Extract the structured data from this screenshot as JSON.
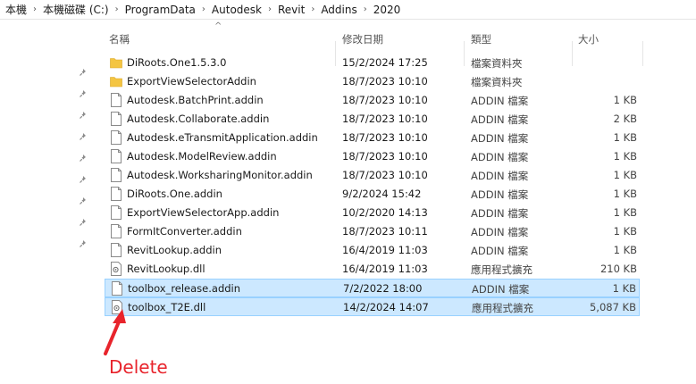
{
  "breadcrumb": {
    "items": [
      "本機",
      "本機磁碟 (C:)",
      "ProgramData",
      "Autodesk",
      "Revit",
      "Addins",
      "2020"
    ]
  },
  "columns": {
    "name": "名稱",
    "date": "修改日期",
    "type": "類型",
    "size": "大小"
  },
  "files": [
    {
      "name": "DiRoots.One1.5.3.0",
      "date": "15/2/2024 17:25",
      "type": "檔案資料夾",
      "size": "",
      "icon": "folder-icon"
    },
    {
      "name": "ExportViewSelectorAddin",
      "date": "18/7/2023 10:10",
      "type": "檔案資料夾",
      "size": "",
      "icon": "folder-icon"
    },
    {
      "name": "Autodesk.BatchPrint.addin",
      "date": "18/7/2023 10:10",
      "type": "ADDIN 檔案",
      "size": "1 KB",
      "icon": "file-icon"
    },
    {
      "name": "Autodesk.Collaborate.addin",
      "date": "18/7/2023 10:10",
      "type": "ADDIN 檔案",
      "size": "2 KB",
      "icon": "file-icon"
    },
    {
      "name": "Autodesk.eTransmitApplication.addin",
      "date": "18/7/2023 10:10",
      "type": "ADDIN 檔案",
      "size": "1 KB",
      "icon": "file-icon"
    },
    {
      "name": "Autodesk.ModelReview.addin",
      "date": "18/7/2023 10:10",
      "type": "ADDIN 檔案",
      "size": "1 KB",
      "icon": "file-icon"
    },
    {
      "name": "Autodesk.WorksharingMonitor.addin",
      "date": "18/7/2023 10:10",
      "type": "ADDIN 檔案",
      "size": "1 KB",
      "icon": "file-icon"
    },
    {
      "name": "DiRoots.One.addin",
      "date": "9/2/2024 15:42",
      "type": "ADDIN 檔案",
      "size": "1 KB",
      "icon": "file-icon"
    },
    {
      "name": "ExportViewSelectorApp.addin",
      "date": "10/2/2020 14:13",
      "type": "ADDIN 檔案",
      "size": "1 KB",
      "icon": "file-icon"
    },
    {
      "name": "FormItConverter.addin",
      "date": "18/7/2023 10:11",
      "type": "ADDIN 檔案",
      "size": "1 KB",
      "icon": "file-icon"
    },
    {
      "name": "RevitLookup.addin",
      "date": "16/4/2019 11:03",
      "type": "ADDIN 檔案",
      "size": "1 KB",
      "icon": "file-icon"
    },
    {
      "name": "RevitLookup.dll",
      "date": "16/4/2019 11:03",
      "type": "應用程式擴充",
      "size": "210 KB",
      "icon": "dll-icon"
    },
    {
      "name": "toolbox_release.addin",
      "date": "7/2/2022 18:00",
      "type": "ADDIN 檔案",
      "size": "1 KB",
      "icon": "file-icon",
      "selected": true
    },
    {
      "name": "toolbox_T2E.dll",
      "date": "14/2/2024 14:07",
      "type": "應用程式擴充",
      "size": "5,087 KB",
      "icon": "dll-icon",
      "selected": true
    }
  ],
  "annotation": {
    "label": "Delete",
    "color": "#e8242c"
  },
  "colors": {
    "selection_bg": "#cce8ff",
    "selection_border": "#99d1ff",
    "folder": "#f4c542"
  }
}
